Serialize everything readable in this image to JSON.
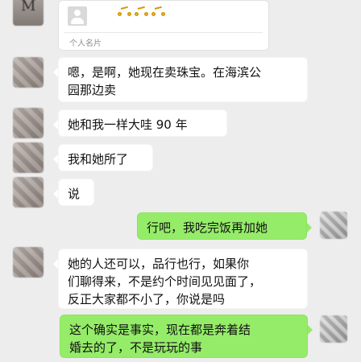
{
  "contact_card": {
    "top_avatar_letter": "M",
    "label": "个人名片",
    "icons": [
      "bike-icon",
      "bike-icon",
      "bike-icon"
    ]
  },
  "messages": [
    {
      "side": "left",
      "text": "嗯，是啊，她现在卖珠宝。在海滨公\n园那边卖"
    },
    {
      "side": "left",
      "text": "她和我一样大哇 90 年"
    },
    {
      "side": "left",
      "text": "我和她所了"
    },
    {
      "side": "left",
      "text": "说"
    },
    {
      "side": "right",
      "text": "行吧，我吃完饭再加她"
    },
    {
      "side": "left",
      "text": "她的人还可以，品行也行，如果你\n们聊得来，不是约个时间见见面了，\n反正大家都不小了，你说是吗"
    },
    {
      "side": "right",
      "text": "这个确实是事实，现在都是奔着结\n婚去的了，不是玩玩的事"
    }
  ]
}
